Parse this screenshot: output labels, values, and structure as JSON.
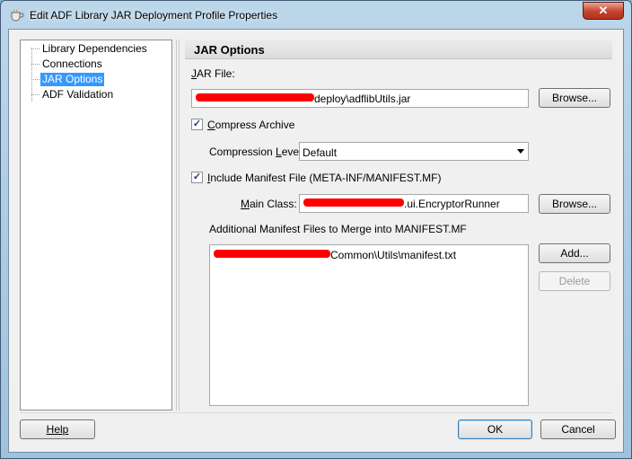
{
  "window": {
    "title": "Edit ADF Library JAR Deployment Profile Properties",
    "close_symbol": "✕"
  },
  "nav": {
    "items": [
      {
        "label": "Library Dependencies",
        "selected": false
      },
      {
        "label": "Connections",
        "selected": false
      },
      {
        "label": "JAR Options",
        "selected": true
      },
      {
        "label": "ADF Validation",
        "selected": false
      }
    ]
  },
  "panel": {
    "title": "JAR Options",
    "jar_file": {
      "label_prefix": "",
      "label_mnemonic": "J",
      "label_rest": "AR File:",
      "value_suffix": "deploy\\adflibUtils.jar",
      "browse_label": "Browse..."
    },
    "compress": {
      "checked": true,
      "label_mnemonic": "C",
      "label_rest": "ompress Archive"
    },
    "compression_level": {
      "label_prefix": "Compression ",
      "label_mnemonic": "L",
      "label_rest": "evel",
      "value": "Default"
    },
    "manifest": {
      "checked": true,
      "label_mnemonic": "I",
      "label_rest": "nclude Manifest File (META-INF/MANIFEST.MF)"
    },
    "main_class": {
      "label_prefix": "",
      "label_mnemonic": "M",
      "label_rest": "ain Class:",
      "value_suffix": ".ui.EncryptorRunner",
      "browse_label": "Browse..."
    },
    "additional": {
      "label": "Additional Manifest Files to Merge into MANIFEST.MF",
      "items": [
        "Common\\Utils\\manifest.txt"
      ],
      "add_label": "Add...",
      "delete_label": "Delete"
    }
  },
  "footer": {
    "help_label": "Help",
    "ok_label": "OK",
    "cancel_label": "Cancel"
  },
  "colors": {
    "selection": "#3399ff",
    "redaction": "#ff0000",
    "close_button": "#c4432d"
  },
  "icons": {
    "app": "jdeveloper-cup-icon",
    "close": "close-icon",
    "dropdown": "chevron-down-icon",
    "check": "checkmark-icon"
  }
}
